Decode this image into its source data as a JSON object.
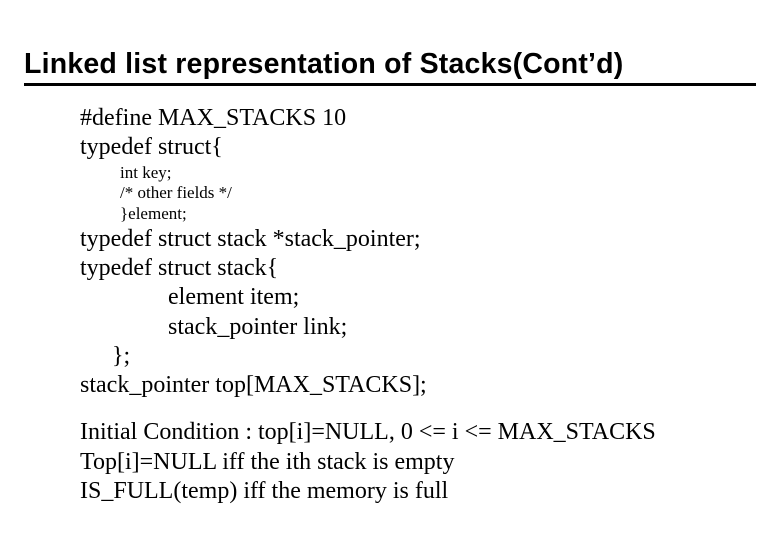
{
  "title": "Linked list representation of Stacks(Cont’d)",
  "lines": {
    "l1": "#define MAX_STACKS  10",
    "l2": "typedef struct{",
    "l3": "int key;",
    "l4": "/* other fields */",
    "l5": "}element;",
    "l6": "typedef struct stack *stack_pointer;",
    "l7": "typedef struct stack{",
    "l8": "element  item;",
    "l9": "stack_pointer link;",
    "l10": "};",
    "l11": "stack_pointer   top[MAX_STACKS];",
    "l12": "Initial Condition : top[i]=NULL, 0 <= i <= MAX_STACKS",
    "l13": "Top[i]=NULL iff the ith stack is empty",
    "l14": "IS_FULL(temp) iff the memory is full"
  }
}
